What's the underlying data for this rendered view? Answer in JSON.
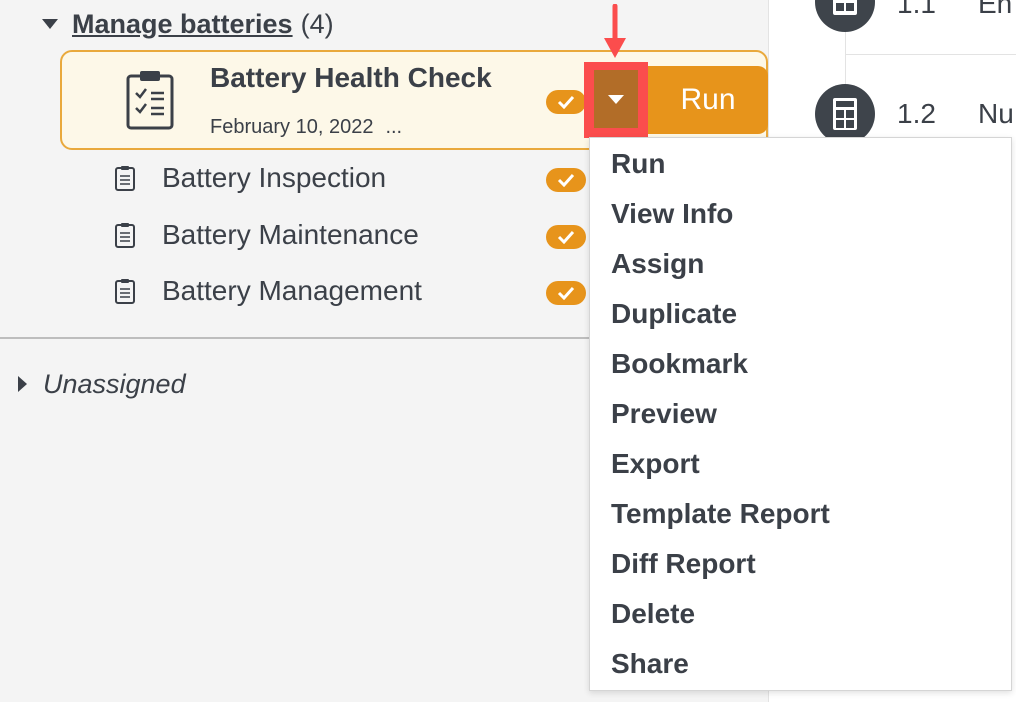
{
  "group": {
    "title": "Manage batteries",
    "count": "(4)"
  },
  "selected_item": {
    "title": "Battery Health Check",
    "date": "February 10, 2022",
    "more": "...",
    "run_label": "Run"
  },
  "items": [
    {
      "label": "Battery Inspection"
    },
    {
      "label": "Battery Maintenance"
    },
    {
      "label": "Battery Management"
    }
  ],
  "unassigned": {
    "label": "Unassigned"
  },
  "outline": [
    {
      "number": "1.1",
      "text": "En"
    },
    {
      "number": "1.2",
      "text": "Nu"
    }
  ],
  "menu": {
    "items": [
      "Run",
      "View Info",
      "Assign",
      "Duplicate",
      "Bookmark",
      "Preview",
      "Export",
      "Template Report",
      "Diff Report",
      "Delete",
      "Share"
    ]
  },
  "colors": {
    "accent": "#e7941b",
    "highlight": "#fb4d4d",
    "dropdown_fill": "#b26d28",
    "card_bg": "#fdf8e8",
    "text": "#3b4048"
  },
  "icons": {
    "checklist": "checklist-icon",
    "check": "check-icon",
    "calculator": "calculator-icon",
    "arrow": "down-arrow-icon"
  }
}
